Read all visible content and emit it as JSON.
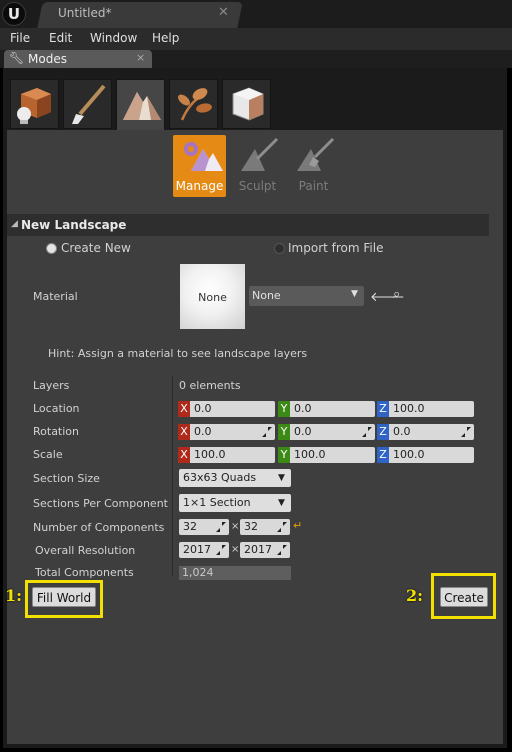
{
  "window": {
    "document_title": "Untitled*",
    "logo": "U"
  },
  "menu": {
    "items": [
      "File",
      "Edit",
      "Window",
      "Help"
    ]
  },
  "panel_tab": {
    "label": "Modes",
    "icon": "wrench-icon",
    "close": "×"
  },
  "mode_tabs": [
    {
      "name": "place-mode",
      "icon": "cube-sphere-icon"
    },
    {
      "name": "paint-mode",
      "icon": "paintbrush-icon"
    },
    {
      "name": "landscape-mode",
      "icon": "mountain-icon",
      "active": true
    },
    {
      "name": "foliage-mode",
      "icon": "leaf-icon"
    },
    {
      "name": "geometry-mode",
      "icon": "geometry-cube-icon"
    }
  ],
  "tools": {
    "manage": "Manage",
    "sculpt": "Sculpt",
    "paint": "Paint"
  },
  "section": {
    "title": "New Landscape"
  },
  "radio": {
    "create_new": "Create New",
    "import_from_file": "Import from File"
  },
  "material": {
    "label": "Material",
    "thumbnail_label": "None",
    "combo_value": "None",
    "hint": "Hint: Assign a material to see landscape layers"
  },
  "layers": {
    "label": "Layers",
    "value": "0 elements"
  },
  "location": {
    "label": "Location",
    "x": "0.0",
    "y": "0.0",
    "z": "100.0"
  },
  "rotation": {
    "label": "Rotation",
    "x": "0.0",
    "y": "0.0",
    "z": "0.0"
  },
  "scale": {
    "label": "Scale",
    "x": "100.0",
    "y": "100.0",
    "z": "100.0"
  },
  "axis_labels": {
    "x": "X",
    "y": "Y",
    "z": "Z"
  },
  "section_size": {
    "label": "Section Size",
    "value": "63x63 Quads"
  },
  "sections_per_component": {
    "label": "Sections Per Component",
    "value": "1×1 Section"
  },
  "number_of_components": {
    "label": "Number of Components",
    "x": "32",
    "y": "32",
    "times": "×"
  },
  "overall_resolution": {
    "label": "Overall Resolution",
    "x": "2017",
    "y": "2017",
    "times": "×"
  },
  "total_components": {
    "label": "Total Components",
    "value": "1,024"
  },
  "buttons": {
    "fill_world": "Fill World",
    "create": "Create"
  },
  "annotations": {
    "one": "1:",
    "two": "2:"
  },
  "colors": {
    "accent": "#e58a14",
    "highlight": "#f2e000",
    "axis_x": "#b02a1c",
    "axis_y": "#3a8a15",
    "axis_z": "#2f63c6"
  }
}
